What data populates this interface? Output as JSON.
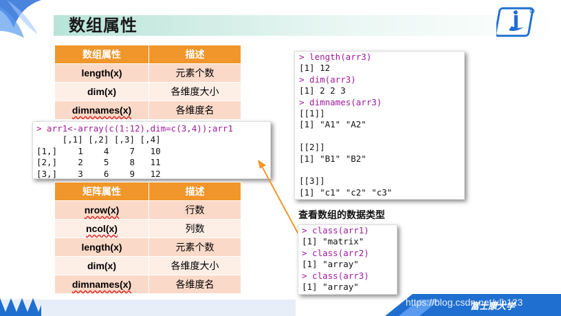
{
  "title": "数组属性",
  "table1": {
    "header": [
      "数组属性",
      "描述"
    ],
    "rows": [
      [
        "length(x)",
        "元素个数"
      ],
      [
        "dim(x)",
        "各维度大小"
      ],
      [
        "dimnames(x)",
        "各维度名"
      ]
    ]
  },
  "table2": {
    "header": [
      "矩阵属性",
      "描述"
    ],
    "rows": [
      [
        "nrow(x)",
        "行数"
      ],
      [
        "ncol(x)",
        "列数"
      ],
      [
        "length(x)",
        "元素个数"
      ],
      [
        "dim(x)",
        "各维度大小"
      ],
      [
        "dimnames(x)",
        "各维度名"
      ]
    ]
  },
  "console1": {
    "lines": [
      "> arr1<-array(c(1:12),dim=c(3,4));arr1",
      "     [,1] [,2] [,3] [,4]",
      "[1,]    1    4    7   10",
      "[2,]    2    5    8   11",
      "[3,]    3    6    9   12"
    ]
  },
  "console2": {
    "lines": [
      "> length(arr3)",
      "[1] 12",
      "> dim(arr3)",
      "[1] 2 2 3",
      "> dimnames(arr3)",
      "[[1]]",
      "[1] \"A1\" \"A2\"",
      "",
      "[[2]]",
      "[1] \"B1\" \"B2\"",
      "",
      "[[3]]",
      "[1] \"c1\" \"c2\" \"c3\""
    ]
  },
  "caption": "查看数组的数据类型",
  "console3": {
    "lines": [
      "> class(arr1)",
      "[1] \"matrix\"",
      "> class(arr2)",
      "[1] \"array\"",
      "> class(arr3)",
      "[1] \"array\""
    ]
  },
  "footer": {
    "watermark": "https://blog.csdn.net/xlh123",
    "university": "富士康大学"
  },
  "colors": {
    "header_orange": "#f0962a",
    "row_peach": "#fbd9c8",
    "cmd_purple": "#a0199c",
    "band_blue": "#1f6fd0"
  }
}
